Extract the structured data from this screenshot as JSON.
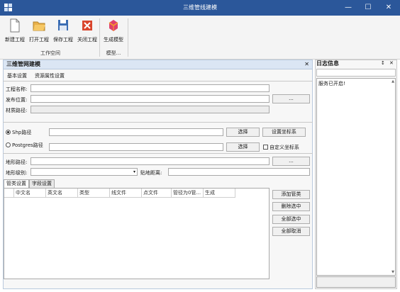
{
  "window": {
    "title": "三维管线建模",
    "minimize_glyph": "—",
    "maximize_glyph": "☐",
    "close_glyph": "✕"
  },
  "ribbon": {
    "buttons": [
      {
        "label": "新建工程",
        "icon": "new-file-icon"
      },
      {
        "label": "打开工程",
        "icon": "open-folder-icon"
      },
      {
        "label": "保存工程",
        "icon": "save-icon"
      },
      {
        "label": "关闭工程",
        "icon": "close-project-icon"
      },
      {
        "label": "生成模型",
        "icon": "generate-model-icon"
      }
    ],
    "groups": [
      "工作空间",
      "模型..."
    ]
  },
  "panel": {
    "title": "三维管网建模",
    "close_glyph": "✕",
    "subtabs": [
      "基本设置",
      "资源属性设置"
    ],
    "fields": {
      "project_name_label": "工程名称:",
      "publish_location_label": "发布位置:",
      "material_path_label": "材质路径:",
      "browse_label": "...",
      "shp_label": "Shp路径",
      "postgres_label": "Postgres路径",
      "select_label": "选择",
      "set_coords_label": "设置坐标系",
      "custom_coords_label": "自定义坐标系",
      "terrain_path_label": "地形路径:",
      "terrain_level_label": "地形级别:",
      "ground_distance_label": "贴地距离:"
    },
    "lower_tabs": [
      "管类设置",
      "字段设置"
    ],
    "table_columns": [
      "中文名",
      "英文名",
      "类型",
      "线文件",
      "点文件",
      "管径为0管...",
      "生成"
    ],
    "actions": [
      "添加管类",
      "删除选中",
      "全部选中",
      "全部取消"
    ]
  },
  "log": {
    "title": "日志信息",
    "pin_glyph": "↕",
    "close_glyph": "✕",
    "entries": [
      "服务已开启!"
    ]
  },
  "colors": {
    "titlebar": "#2b579a",
    "panel_header": "#dbe6f4"
  }
}
